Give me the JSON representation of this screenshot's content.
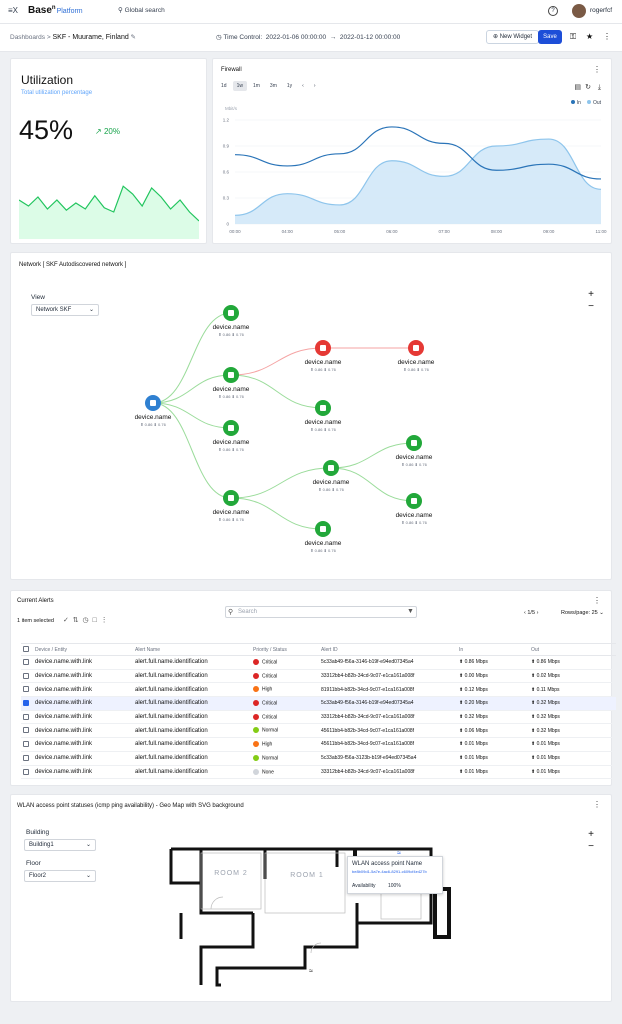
{
  "topbar": {
    "logo_mark": "≡X",
    "brand": "Base",
    "brand_sup": "n",
    "brand_suffix": "Platform",
    "search_label": "Global search",
    "help": "?",
    "user": "rogerfcf"
  },
  "subbar": {
    "breadcrumb_root": "Dashboards",
    "breadcrumb_sep": ">",
    "page_title": "SKF - Muurame, Finland",
    "time_control_label": "Time Control:",
    "time_from": "2022-01-06 00:00:00",
    "arrow": "→",
    "time_to": "2022-01-12 00:00:00",
    "new_widget": "New Widget",
    "save": "Save"
  },
  "utilization": {
    "title": "Utilization",
    "subtitle": "Total utilization percentage",
    "value": "45%",
    "delta": "20%",
    "sparkline": [
      0.55,
      0.45,
      0.6,
      0.4,
      0.55,
      0.38,
      0.5,
      0.4,
      0.62,
      0.42,
      0.35,
      0.78,
      0.65,
      0.45,
      0.75,
      0.6,
      0.4,
      0.55,
      0.35,
      0.2
    ]
  },
  "firewall": {
    "title": "Firewall",
    "ranges": [
      "1d",
      "1w",
      "1m",
      "3m",
      "1y"
    ],
    "active_range": "1w",
    "legend_in": "In",
    "legend_out": "Out",
    "colors": {
      "in": "#2a74b8",
      "out": "#8ec5ec"
    }
  },
  "chart_data": {
    "type": "line",
    "title": "Firewall",
    "ylabel": "Mbit/s",
    "x": [
      "00:00",
      "04:00",
      "05:00",
      "06:00",
      "07:00",
      "08:00",
      "09:00",
      "11:00"
    ],
    "yticks": [
      "0",
      "0.3",
      "0.6",
      "0.9",
      "1.2"
    ],
    "ylim": [
      0,
      1.2
    ],
    "series": [
      {
        "name": "In",
        "values": [
          0.8,
          0.67,
          0.81,
          1.12,
          0.93,
          0.62,
          0.69,
          0.52
        ]
      },
      {
        "name": "Out",
        "values": [
          0.1,
          0.35,
          0.22,
          0.73,
          0.55,
          0.9,
          0.98,
          0.4
        ]
      }
    ]
  },
  "network": {
    "title": "Network [ SKF Autodiscovered network ]",
    "view_label": "View",
    "view_value": "Network SKF",
    "zoom_in": "+",
    "zoom_out": "−",
    "nodes": [
      {
        "name": "device.name",
        "stats": "⬆ 0.86  ⬇ 0.76",
        "status": "info"
      },
      {
        "name": "device.name",
        "stats": "⬆ 0.86  ⬇ 0.76",
        "status": "ok"
      },
      {
        "name": "device.name",
        "stats": "⬆ 0.86  ⬇ 0.76",
        "status": "ok"
      },
      {
        "name": "device.name",
        "stats": "⬆ 0.86  ⬇ 0.76",
        "status": "ok"
      },
      {
        "name": "device.name",
        "stats": "⬆ 0.86  ⬇ 0.76",
        "status": "ok"
      },
      {
        "name": "device.name",
        "stats": "⬆ 0.86  ⬇ 0.76",
        "status": "error"
      },
      {
        "name": "device.name",
        "stats": "⬆ 0.86  ⬇ 0.76",
        "status": "error"
      },
      {
        "name": "device.name",
        "stats": "⬆ 0.86  ⬇ 0.76",
        "status": "ok"
      },
      {
        "name": "device.name",
        "stats": "⬆ 0.86  ⬇ 0.76",
        "status": "ok"
      },
      {
        "name": "device.name",
        "stats": "⬆ 0.86  ⬇ 0.76",
        "status": "ok"
      },
      {
        "name": "device.name",
        "stats": "⬆ 0.86  ⬇ 0.76",
        "status": "ok"
      },
      {
        "name": "device.name",
        "stats": "⬆ 0.86  ⬇ 0.76",
        "status": "ok"
      }
    ]
  },
  "alerts": {
    "title": "Current Alerts",
    "selected": "1 item selected",
    "search_placeholder": "Search",
    "page": "1/5",
    "rows_label": "Rows/page:",
    "rows_value": "25",
    "columns": [
      "Device / Entity",
      "Alert Name",
      "Priority / Status",
      "Alert ID",
      "In",
      "Out"
    ],
    "rows": [
      {
        "device": "device.name.with.link",
        "alert": "alert.full.name.identification",
        "priority": "Critical",
        "color": "#dc2626",
        "id": "5c33ab49-f56a-3146-b19f-e94ed07345a4",
        "in": "⬆ 0.86 Mbps",
        "out": "⬆ 0.86 Mbps",
        "checked": false
      },
      {
        "device": "device.name.with.link",
        "alert": "alert.full.name.identification",
        "priority": "Critical",
        "color": "#dc2626",
        "id": "33312bb4-b82b-34cd-9c07-e1ca161a008f",
        "in": "⬆ 0.00 Mbps",
        "out": "⬆ 0.02 Mbps",
        "checked": false
      },
      {
        "device": "device.name.with.link",
        "alert": "alert.full.name.identification",
        "priority": "High",
        "color": "#f97316",
        "id": "81911bb4-b82b-34cd-9c07-e1ca161a008f",
        "in": "⬆ 0.12 Mbps",
        "out": "⬆ 0.11 Mbps",
        "checked": false
      },
      {
        "device": "device.name.with.link",
        "alert": "alert.full.name.identification",
        "priority": "Critical",
        "color": "#dc2626",
        "id": "5c33ab49-f56a-3146-b19f-e94ed07345a4",
        "in": "⬆ 0.20 Mbps",
        "out": "⬆ 0.32 Mbps",
        "checked": true
      },
      {
        "device": "device.name.with.link",
        "alert": "alert.full.name.identification",
        "priority": "Critical",
        "color": "#dc2626",
        "id": "33312bb4-b82b-34cd-9c07-e1ca161a008f",
        "in": "⬆ 0.32 Mbps",
        "out": "⬆ 0.32 Mbps",
        "checked": false
      },
      {
        "device": "device.name.with.link",
        "alert": "alert.full.name.identification",
        "priority": "Normal",
        "color": "#84cc16",
        "id": "45611bb4-b82b-34cd-9c07-e1ca161a008f",
        "in": "⬆ 0.06 Mbps",
        "out": "⬆ 0.32 Mbps",
        "checked": false
      },
      {
        "device": "device.name.with.link",
        "alert": "alert.full.name.identification",
        "priority": "High",
        "color": "#f97316",
        "id": "45611bb4-b82b-34cd-9c07-e1ca161a008f",
        "in": "⬆ 0.01 Mbps",
        "out": "⬆ 0.01 Mbps",
        "checked": false
      },
      {
        "device": "device.name.with.link",
        "alert": "alert.full.name.identification",
        "priority": "Normal",
        "color": "#84cc16",
        "id": "5c33ab39-f56a-3123b-b19f-e94ed07345a4",
        "in": "⬆ 0.01 Mbps",
        "out": "⬆ 0.01 Mbps",
        "checked": false
      },
      {
        "device": "device.name.with.link",
        "alert": "alert.full.name.identification",
        "priority": "None",
        "color": "#d1d5db",
        "id": "33312bb4-b82b-34cd-9c07-e1ca161a008f",
        "in": "⬆ 0.01 Mbps",
        "out": "⬆ 0.01 Mbps",
        "checked": false
      }
    ]
  },
  "wlan": {
    "title": "WLAN access point statuses (icmp ping availability) - Geo Map with SVG background",
    "building_label": "Building",
    "building_value": "Building1",
    "floor_label": "Floor",
    "floor_value": "Floor2",
    "room1": "ROOM 1",
    "room2": "ROOM 2",
    "tooltip_title": "WLAN access point Name",
    "tooltip_id": "be8b09d1-5a7e-4ac6-8291-c609cf4e427b",
    "tooltip_key": "Availability",
    "tooltip_value": "100%"
  }
}
